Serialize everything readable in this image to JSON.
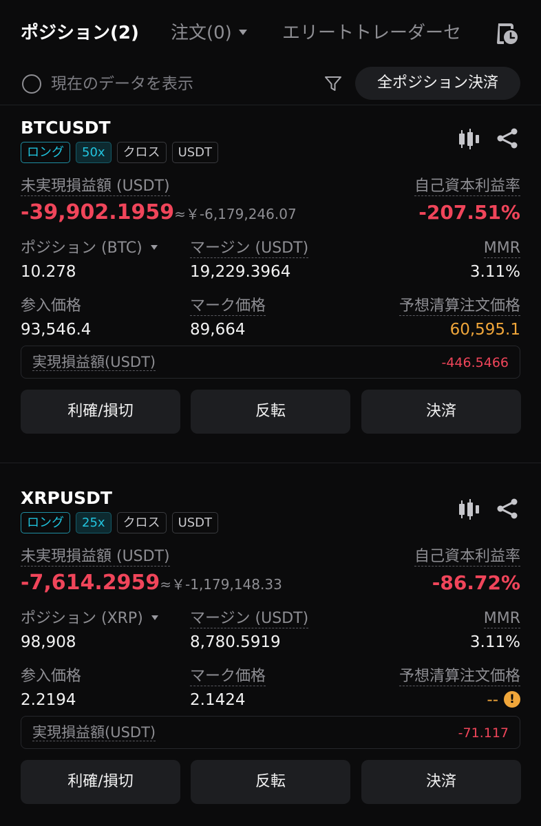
{
  "tabs": {
    "positions": "ポジション(2)",
    "orders": "注文(0)",
    "elite": "エリートトレーダーセ"
  },
  "filter": {
    "show_current": "現在のデータを表示",
    "close_all": "全ポジション決済"
  },
  "positions": [
    {
      "symbol": "BTCUSDT",
      "badges": {
        "side": "ロング",
        "leverage": "50x",
        "mode": "クロス",
        "margin_coin": "USDT"
      },
      "labels": {
        "upnl": "未実現損益額 (USDT)",
        "roe": "自己資本利益率",
        "position": "ポジション (BTC)",
        "margin": "マージン (USDT)",
        "mmr": "MMR",
        "entry": "参入価格",
        "mark": "マーク価格",
        "liq": "予想清算注文価格",
        "realized": "実現損益額(USDT)"
      },
      "upnl": "-39,902.1959",
      "upnl_jpy": "≈￥-6,179,246.07",
      "roe": "-207.51%",
      "position": "10.278",
      "margin": "19,229.3964",
      "mmr": "3.11%",
      "entry": "93,546.4",
      "mark": "89,664",
      "liq": "60,595.1",
      "realized": "-446.5466",
      "buttons": {
        "tpsl": "利確/損切",
        "reverse": "反転",
        "close": "決済"
      }
    },
    {
      "symbol": "XRPUSDT",
      "badges": {
        "side": "ロング",
        "leverage": "25x",
        "mode": "クロス",
        "margin_coin": "USDT"
      },
      "labels": {
        "upnl": "未実現損益額 (USDT)",
        "roe": "自己資本利益率",
        "position": "ポジション (XRP)",
        "margin": "マージン (USDT)",
        "mmr": "MMR",
        "entry": "参入価格",
        "mark": "マーク価格",
        "liq": "予想清算注文価格",
        "realized": "実現損益額(USDT)"
      },
      "upnl": "-7,614.2959",
      "upnl_jpy": "≈￥-1,179,148.33",
      "roe": "-86.72%",
      "position": "98,908",
      "margin": "8,780.5919",
      "mmr": "3.11%",
      "entry": "2.2194",
      "mark": "2.1424",
      "liq": "--",
      "realized": "-71.117",
      "buttons": {
        "tpsl": "利確/損切",
        "reverse": "反転",
        "close": "決済"
      }
    }
  ],
  "colors": {
    "loss": "#f0455a",
    "warning": "#f0a63a",
    "accent": "#1fc2dd",
    "background": "#0b0b0c"
  }
}
